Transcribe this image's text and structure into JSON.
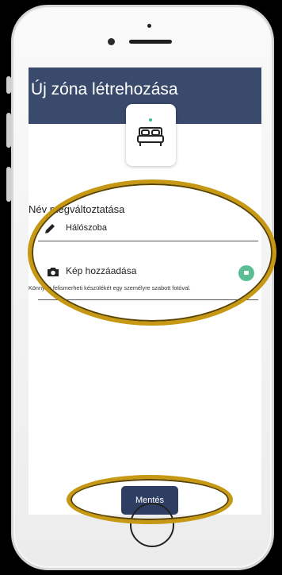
{
  "header": {
    "title": "Új zóna létrehozása"
  },
  "zone": {
    "icon": "bed-icon",
    "status_color": "#3cc08a"
  },
  "rename": {
    "label": "Név megváltoztatása",
    "value": "Hálószoba",
    "icon": "pencil-icon"
  },
  "photo": {
    "title": "Kép hozzáadása",
    "description": "Könnyen felismerheti készülékét egy személyre szabott fotóval.",
    "icon": "camera-icon",
    "action_icon": "add-photo-icon"
  },
  "actions": {
    "save_label": "Mentés"
  },
  "colors": {
    "header": "#3a4a6d",
    "primary": "#2e3e62",
    "accent": "#5cbf94",
    "annotation": "#c69813"
  }
}
